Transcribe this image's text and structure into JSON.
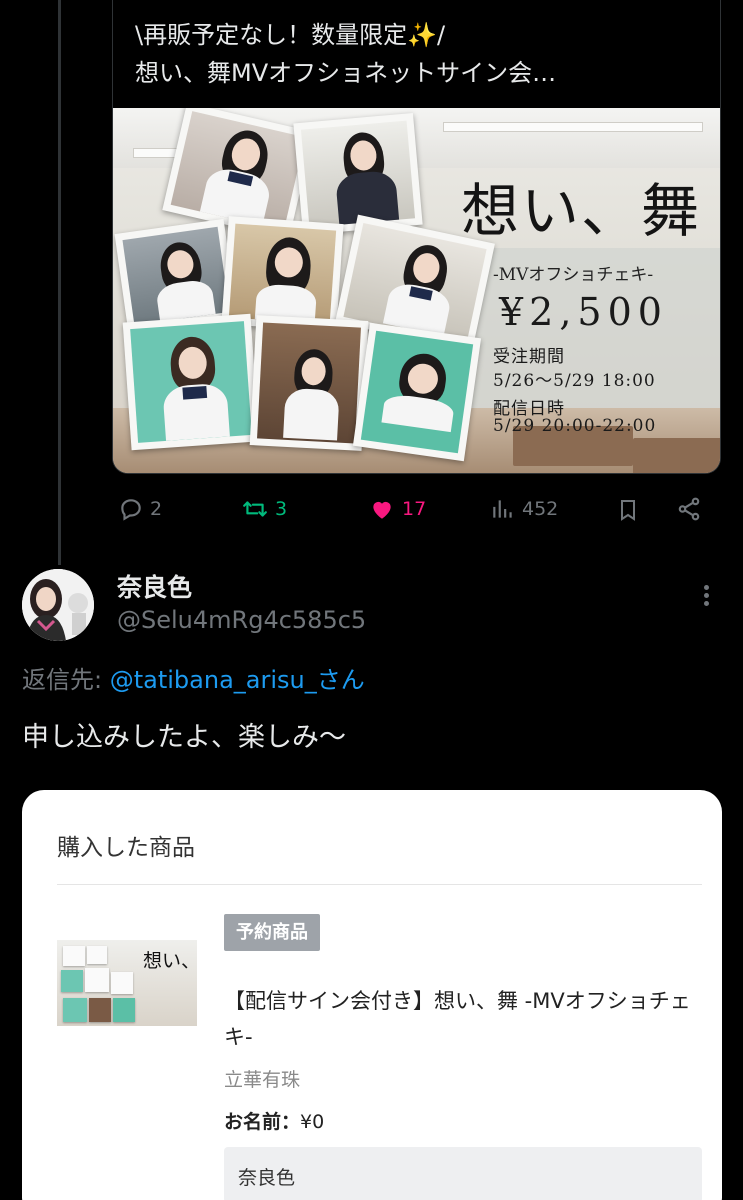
{
  "quoted_tweet": {
    "text_line1": "\\再販予定なし！数量限定✨/",
    "text_line2": "想い、舞MVオフショネットサイン会…",
    "image": {
      "title": "想い、舞",
      "subtitle": "-MVオフショチェキ-",
      "price": "¥2,500",
      "order_period_label": "受注期間",
      "order_period": "5/26〜5/29 18:00",
      "stream_label": "配信日時",
      "stream_time": "5/29 20:00-22:00"
    }
  },
  "actions": {
    "replies": "2",
    "retweets": "3",
    "likes": "17",
    "views": "452"
  },
  "colors": {
    "retweet": "#00ba7c",
    "like": "#f91880",
    "link": "#1d9bf0",
    "muted": "#71767b"
  },
  "reply": {
    "display_name": "奈良色",
    "handle": "@Selu4mRg4c585c5",
    "reply_to_label": "返信先:",
    "reply_to_user": "@tatibana_arisu_さん",
    "text": "申し込みしたよ、楽しみ〜"
  },
  "purchase_card": {
    "header": "購入した商品",
    "badge": "予約商品",
    "product_name": "【配信サイン会付き】想い、舞 -MVオフショチェキ-",
    "seller": "立華有珠",
    "name_label": "お名前：",
    "price": "¥0",
    "name_value": "奈良色"
  }
}
